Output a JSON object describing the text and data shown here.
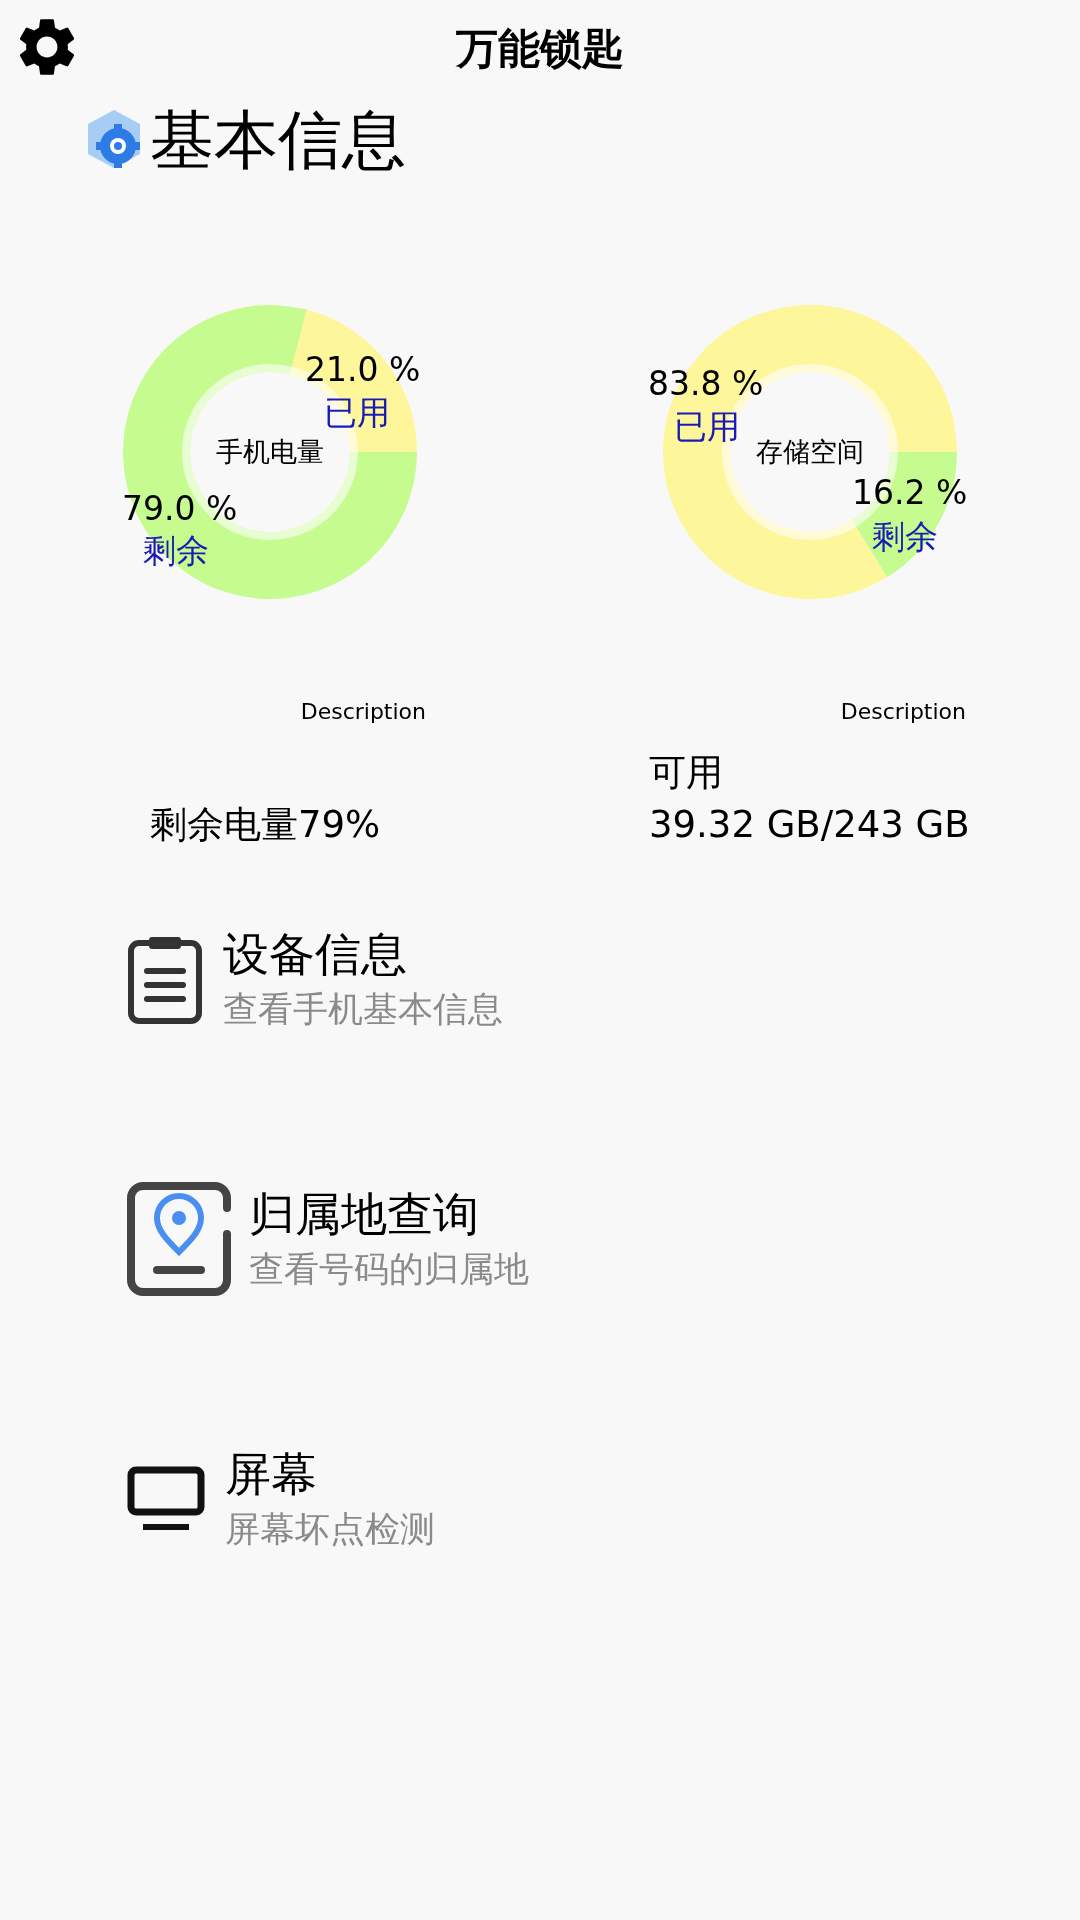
{
  "app_bar": {
    "title": "万能锁匙"
  },
  "section": {
    "title": "基本信息"
  },
  "charts": [
    {
      "description": "Description",
      "lines": [
        "剩余电量79%"
      ],
      "chart_data": {
        "type": "donut",
        "categories": [
          "已用",
          "剩余"
        ],
        "series": [
          {
            "name": "手机电量",
            "values": [
              21.0,
              79.0
            ]
          }
        ],
        "colors": [
          "#fdf69a",
          "#c5fb8f"
        ],
        "value_labels": [
          "21.0 %",
          "79.0 %"
        ]
      }
    },
    {
      "description": "Description",
      "lines": [
        "可用",
        "39.32 GB/243 GB"
      ],
      "chart_data": {
        "type": "donut",
        "categories": [
          "已用",
          "剩余"
        ],
        "series": [
          {
            "name": "存储空间",
            "values": [
              83.8,
              16.2
            ]
          }
        ],
        "colors": [
          "#fdf69a",
          "#c5fb8f"
        ],
        "value_labels": [
          "83.8 %",
          "16.2 %"
        ]
      }
    }
  ],
  "menu": [
    {
      "title": "设备信息",
      "subtitle": "查看手机基本信息"
    },
    {
      "title": "归属地查询",
      "subtitle": "查看号码的归属地"
    },
    {
      "title": "屏幕",
      "subtitle": "屏幕坏点检测"
    }
  ]
}
